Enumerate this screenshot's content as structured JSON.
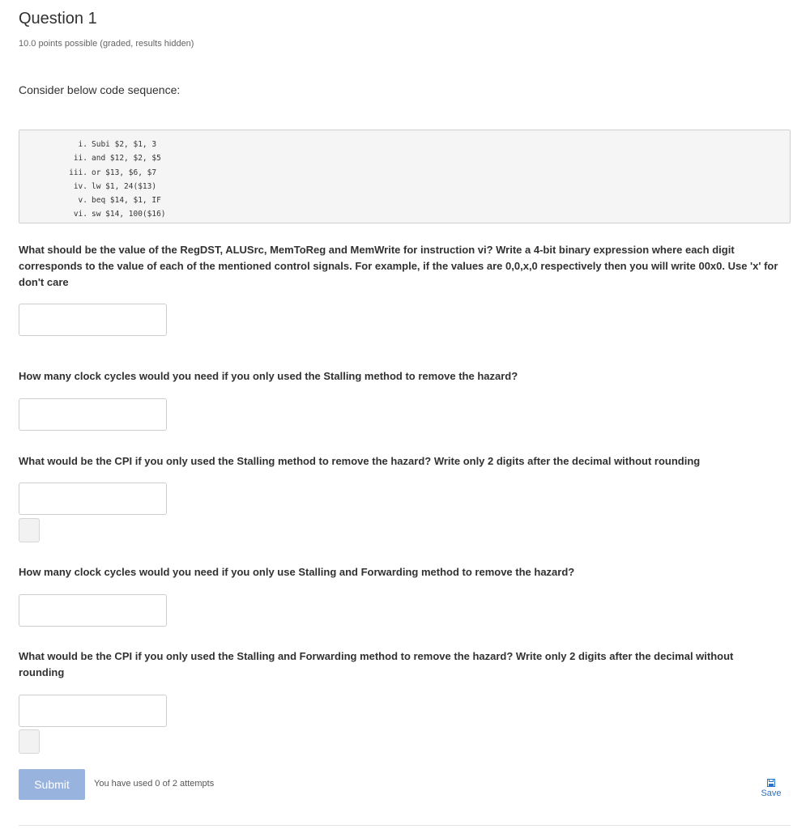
{
  "problem": {
    "title": "Question 1",
    "points": "10.0 points possible (graded, results hidden)",
    "intro": "Consider below code sequence:"
  },
  "code_lines": [
    {
      "num": "i.",
      "instr": "Subi $2, $1, 3"
    },
    {
      "num": "ii.",
      "instr": "and $12, $2, $5"
    },
    {
      "num": "iii.",
      "instr": "or $13, $6, $7"
    },
    {
      "num": "iv.",
      "instr": "lw $1, 24($13)"
    },
    {
      "num": "v.",
      "instr": "beq $14, $1, IF"
    },
    {
      "num": "vi.",
      "instr": "sw $14, 100($16)"
    }
  ],
  "questions": {
    "q1": "What should be the value of the RegDST, ALUSrc, MemToReg and MemWrite for instruction vi? Write a 4-bit binary expression where each digit corresponds to the value of each of the mentioned control signals. For example, if the values are 0,0,x,0 respectively then you will write 00x0. Use 'x' for don't care",
    "q2": "How many clock cycles would you need if you only used the Stalling method to remove the hazard?",
    "q3": "What would be the CPI if you only used the Stalling method to remove the hazard? Write only 2 digits after the decimal without rounding",
    "q4": "How many clock cycles would you need if you only use Stalling and Forwarding method to remove the hazard?",
    "q5": "What would be the CPI if you only used the Stalling and Forwarding method to remove the hazard? Write only 2 digits after the decimal without rounding"
  },
  "answers": {
    "a1": "",
    "a2": "",
    "a3": "",
    "a4": "",
    "a5": ""
  },
  "actions": {
    "submit_label": "Submit",
    "attempts_text": "You have used 0 of 2 attempts",
    "save_label": "Save"
  },
  "colors": {
    "submit_bg": "#98b4de",
    "link": "#2a73c8"
  },
  "icons": {
    "save": "floppy-disk-icon"
  }
}
